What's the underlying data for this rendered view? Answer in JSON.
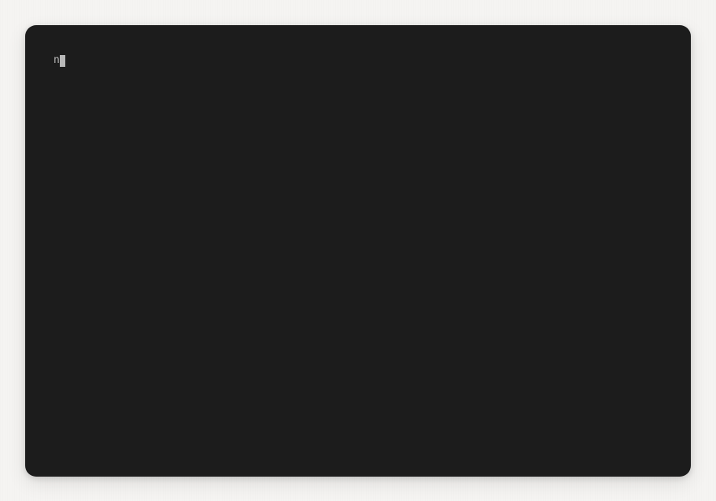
{
  "terminal": {
    "input_text": "n",
    "cursor_visible": true
  }
}
